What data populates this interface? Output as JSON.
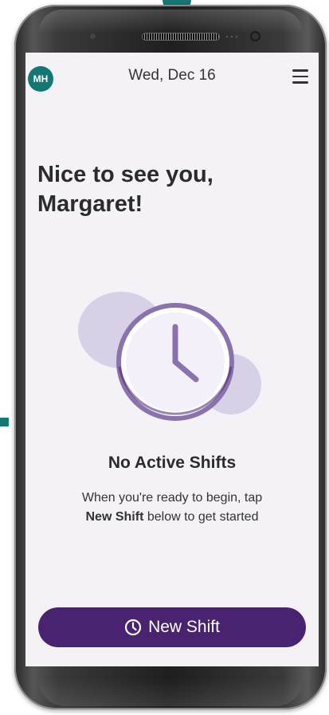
{
  "user": {
    "initials": "MH"
  },
  "header": {
    "date": "Wed, Dec 16"
  },
  "main": {
    "greeting_line1": "Nice to see you,",
    "greeting_line2": "Margaret!",
    "empty_title": "No Active Shifts",
    "help_line1": "When you're ready to begin, tap",
    "help_bold": "New Shift",
    "help_line2_rest": " below to get started"
  },
  "actions": {
    "new_shift_label": "New Shift"
  },
  "icons": {
    "menu": "hamburger-menu-icon",
    "clock": "clock-icon",
    "button_clock": "clock-outline-icon"
  },
  "colors": {
    "teal": "#137774",
    "purple": "#4a2370",
    "lavender": "#d8d0e6",
    "clock_stroke": "#8a72ad"
  }
}
